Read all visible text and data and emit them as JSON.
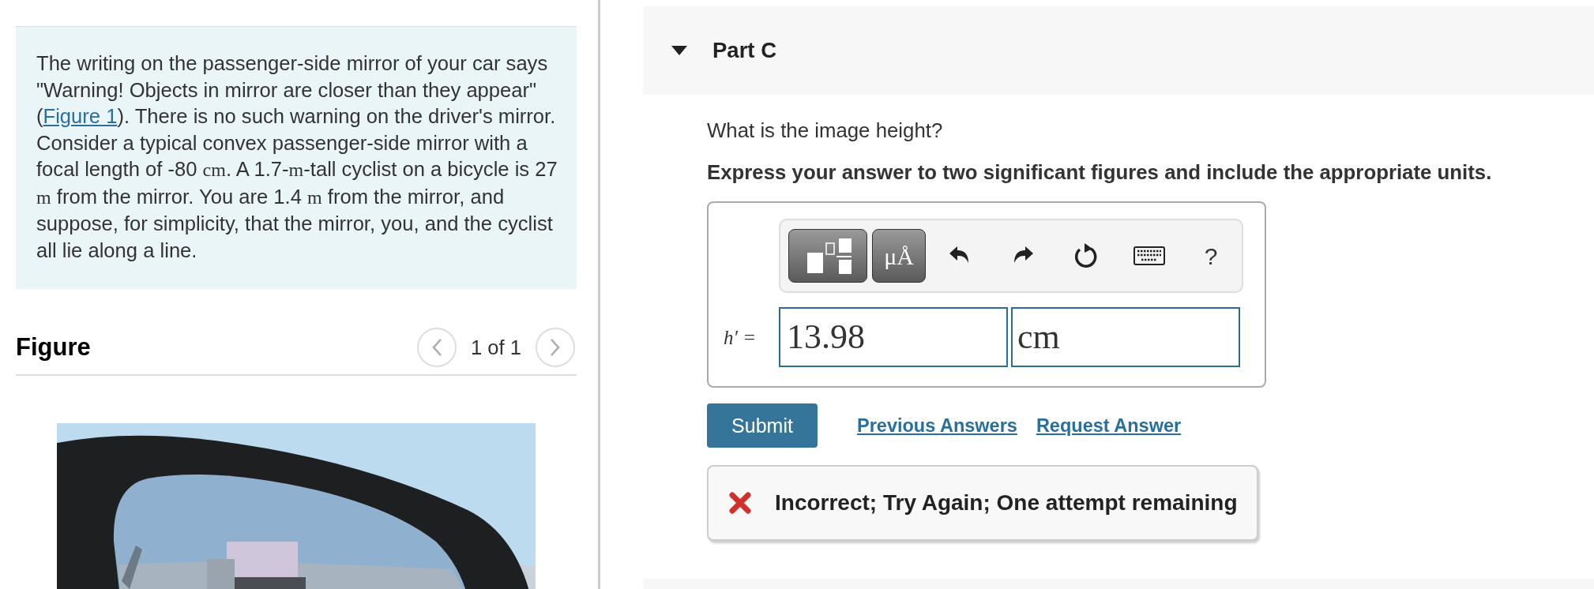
{
  "problem": {
    "segments": [
      {
        "kind": "text",
        "text": "The writing on the passenger-side mirror of your car says \"Warning! Objects in mirror are closer than they appear\" ("
      },
      {
        "kind": "link",
        "text": "Figure 1"
      },
      {
        "kind": "text",
        "text": "). There is no such warning on the driver's mirror. Consider a typical convex passenger-side mirror with a focal length of -80 "
      },
      {
        "kind": "math",
        "text": "cm"
      },
      {
        "kind": "text",
        "text": ". A 1.7-"
      },
      {
        "kind": "math",
        "text": "m"
      },
      {
        "kind": "text",
        "text": "-tall cyclist on a bicycle is 27 "
      },
      {
        "kind": "math",
        "text": "m"
      },
      {
        "kind": "text",
        "text": " from the mirror. You are 1.4 "
      },
      {
        "kind": "math",
        "text": "m"
      },
      {
        "kind": "text",
        "text": " from the mirror, and suppose, for simplicity, that the mirror, you, and the cyclist all lie along a line."
      }
    ]
  },
  "figure": {
    "title": "Figure",
    "pager": "1 of 1"
  },
  "part": {
    "title": "Part C",
    "expanded": true,
    "question": "What is the image height?",
    "instruction": "Express your answer to two significant figures and include the appropriate units.",
    "toolbar": [
      {
        "kind": "templates"
      },
      {
        "kind": "units",
        "label": "μÅ"
      },
      {
        "kind": "undo"
      },
      {
        "kind": "redo"
      },
      {
        "kind": "reset"
      },
      {
        "kind": "keyboard"
      },
      {
        "kind": "help",
        "label": "?"
      }
    ],
    "answer": {
      "variable": "h′ =",
      "value": "13.98",
      "unit": "cm"
    },
    "submit": "Submit",
    "links": [
      "Previous Answers",
      "Request Answer"
    ],
    "feedback": {
      "correct": false,
      "text": "Incorrect; Try Again; One attempt remaining"
    }
  }
}
